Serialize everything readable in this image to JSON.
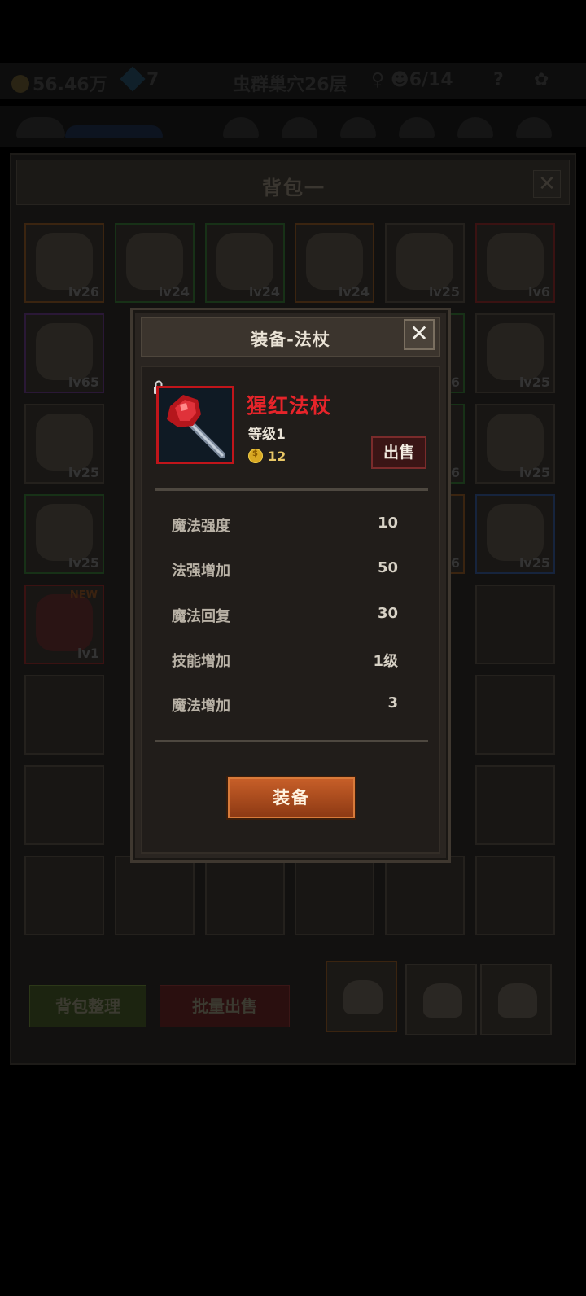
{
  "topbar": {
    "gold": "56.46万",
    "gems": "7",
    "stage": "虫群巢穴26层",
    "keys": "6/14",
    "help": "?"
  },
  "bag": {
    "title": "背包一",
    "close_label": "✕",
    "sort_label": "背包整理",
    "batch_sell_label": "批量出售",
    "slots": [
      {
        "level": "lv26",
        "rarity": "orange",
        "icon": "spear-icon"
      },
      {
        "level": "lv24",
        "rarity": "green",
        "icon": "boots-icon"
      },
      {
        "level": "lv24",
        "rarity": "green",
        "icon": "boots-icon"
      },
      {
        "level": "lv24",
        "rarity": "orange",
        "icon": "shield-icon"
      },
      {
        "level": "lv25",
        "rarity": "gray",
        "icon": "club-icon"
      },
      {
        "level": "lv6",
        "rarity": "red",
        "icon": "helmet-icon"
      },
      {
        "level": "lv65",
        "rarity": "purple",
        "icon": "mask-icon"
      },
      {
        "level": "lv25",
        "rarity": "gray",
        "icon": "spear-icon"
      },
      {
        "level": "lv25",
        "rarity": "gray",
        "icon": "helmet-icon"
      },
      {
        "level": "lv25",
        "rarity": "gray",
        "icon": "shield-icon"
      },
      {
        "level": "lv25",
        "rarity": "green",
        "icon": "axe-icon"
      },
      {
        "level": "lv25",
        "rarity": "blue",
        "icon": "bow-icon"
      },
      {
        "level": "lv1",
        "rarity": "red",
        "icon": "staff-icon",
        "badge": "NEW"
      }
    ],
    "peek_levels": [
      "6",
      "6",
      "6"
    ]
  },
  "modal": {
    "title": "装备-法杖",
    "close_label": "✕",
    "item_name": "猩红法杖",
    "item_level": "等级1",
    "price": "12",
    "sell_label": "出售",
    "stats": [
      {
        "name": "魔法强度",
        "value": "10"
      },
      {
        "name": "法强增加",
        "value": "50"
      },
      {
        "name": "魔法回复",
        "value": "30"
      },
      {
        "name": "技能增加",
        "value": "1级"
      },
      {
        "name": "魔法增加",
        "value": "3"
      }
    ],
    "equip_label": "装备"
  },
  "colors": {
    "item_name": "#e6242a",
    "rarity_red": "#c0151a",
    "equip_button": "#c65e28"
  }
}
